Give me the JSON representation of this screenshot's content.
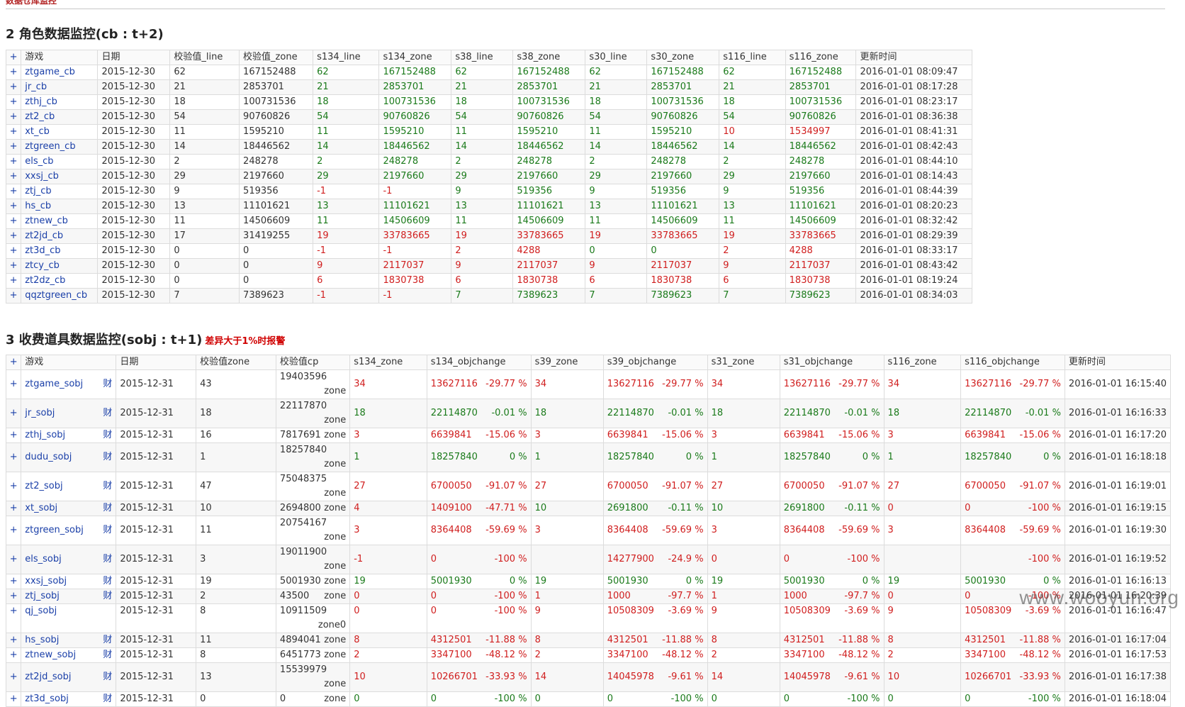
{
  "header": {
    "title": "数据仓库监控"
  },
  "section2": {
    "title": "2 角色数据监控(cb : t+2)",
    "columns": [
      "+",
      "游戏",
      "日期",
      "校验值_line",
      "校验值_zone",
      "s134_line",
      "s134_zone",
      "s38_line",
      "s38_zone",
      "s30_line",
      "s30_zone",
      "s116_line",
      "s116_zone",
      "更新时间"
    ],
    "rows": [
      [
        "ztgame_cb",
        "2015-12-30",
        "62",
        "167152488",
        "62",
        "167152488",
        "62",
        "167152488",
        "62",
        "167152488",
        "62",
        "167152488",
        "2016-01-01 08:09:47"
      ],
      [
        "jr_cb",
        "2015-12-30",
        "21",
        "2853701",
        "21",
        "2853701",
        "21",
        "2853701",
        "21",
        "2853701",
        "21",
        "2853701",
        "2016-01-01 08:17:28"
      ],
      [
        "zthj_cb",
        "2015-12-30",
        "18",
        "100731536",
        "18",
        "100731536",
        "18",
        "100731536",
        "18",
        "100731536",
        "18",
        "100731536",
        "2016-01-01 08:23:17"
      ],
      [
        "zt2_cb",
        "2015-12-30",
        "54",
        "90760826",
        "54",
        "90760826",
        "54",
        "90760826",
        "54",
        "90760826",
        "54",
        "90760826",
        "2016-01-01 08:36:38"
      ],
      [
        "xt_cb",
        "2015-12-30",
        "11",
        "1595210",
        "11",
        "1595210",
        "11",
        "1595210",
        "11",
        "1595210",
        "10",
        "1534997",
        "2016-01-01 08:41:31"
      ],
      [
        "ztgreen_cb",
        "2015-12-30",
        "14",
        "18446562",
        "14",
        "18446562",
        "14",
        "18446562",
        "14",
        "18446562",
        "14",
        "18446562",
        "2016-01-01 08:42:43"
      ],
      [
        "els_cb",
        "2015-12-30",
        "2",
        "248278",
        "2",
        "248278",
        "2",
        "248278",
        "2",
        "248278",
        "2",
        "248278",
        "2016-01-01 08:44:10"
      ],
      [
        "xxsj_cb",
        "2015-12-30",
        "29",
        "2197660",
        "29",
        "2197660",
        "29",
        "2197660",
        "29",
        "2197660",
        "29",
        "2197660",
        "2016-01-01 08:14:43"
      ],
      [
        "ztj_cb",
        "2015-12-30",
        "9",
        "519356",
        "-1",
        "-1",
        "9",
        "519356",
        "9",
        "519356",
        "9",
        "519356",
        "2016-01-01 08:44:39"
      ],
      [
        "hs_cb",
        "2015-12-30",
        "13",
        "11101621",
        "13",
        "11101621",
        "13",
        "11101621",
        "13",
        "11101621",
        "13",
        "11101621",
        "2016-01-01 08:20:23"
      ],
      [
        "ztnew_cb",
        "2015-12-30",
        "11",
        "14506609",
        "11",
        "14506609",
        "11",
        "14506609",
        "11",
        "14506609",
        "11",
        "14506609",
        "2016-01-01 08:32:42"
      ],
      [
        "zt2jd_cb",
        "2015-12-30",
        "17",
        "31419255",
        "19",
        "33783665",
        "19",
        "33783665",
        "19",
        "33783665",
        "19",
        "33783665",
        "2016-01-01 08:29:39"
      ],
      [
        "zt3d_cb",
        "2015-12-30",
        "0",
        "0",
        "-1",
        "-1",
        "2",
        "4288",
        "0",
        "0",
        "2",
        "4288",
        "2016-01-01 08:33:17"
      ],
      [
        "ztcy_cb",
        "2015-12-30",
        "0",
        "0",
        "9",
        "2117037",
        "9",
        "2117037",
        "9",
        "2117037",
        "9",
        "2117037",
        "2016-01-01 08:43:42"
      ],
      [
        "zt2dz_cb",
        "2015-12-30",
        "0",
        "0",
        "6",
        "1830738",
        "6",
        "1830738",
        "6",
        "1830738",
        "6",
        "1830738",
        "2016-01-01 08:19:24"
      ],
      [
        "qqztgreen_cb",
        "2015-12-30",
        "7",
        "7389623",
        "-1",
        "-1",
        "7",
        "7389623",
        "7",
        "7389623",
        "7",
        "7389623",
        "2016-01-01 08:34:03"
      ]
    ],
    "row_colors": [
      [
        "g",
        "g",
        "g",
        "g",
        "g",
        "g",
        "g",
        "g"
      ],
      [
        "g",
        "g",
        "g",
        "g",
        "g",
        "g",
        "g",
        "g"
      ],
      [
        "g",
        "g",
        "g",
        "g",
        "g",
        "g",
        "g",
        "g"
      ],
      [
        "g",
        "g",
        "g",
        "g",
        "g",
        "g",
        "g",
        "g"
      ],
      [
        "g",
        "g",
        "g",
        "g",
        "g",
        "g",
        "r",
        "r"
      ],
      [
        "g",
        "g",
        "g",
        "g",
        "g",
        "g",
        "g",
        "g"
      ],
      [
        "g",
        "g",
        "g",
        "g",
        "g",
        "g",
        "g",
        "g"
      ],
      [
        "g",
        "g",
        "g",
        "g",
        "g",
        "g",
        "g",
        "g"
      ],
      [
        "r",
        "r",
        "g",
        "g",
        "g",
        "g",
        "g",
        "g"
      ],
      [
        "g",
        "g",
        "g",
        "g",
        "g",
        "g",
        "g",
        "g"
      ],
      [
        "g",
        "g",
        "g",
        "g",
        "g",
        "g",
        "g",
        "g"
      ],
      [
        "r",
        "r",
        "r",
        "r",
        "r",
        "r",
        "r",
        "r"
      ],
      [
        "r",
        "r",
        "r",
        "r",
        "g",
        "g",
        "r",
        "r"
      ],
      [
        "r",
        "r",
        "r",
        "r",
        "r",
        "r",
        "r",
        "r"
      ],
      [
        "r",
        "r",
        "r",
        "r",
        "r",
        "r",
        "r",
        "r"
      ],
      [
        "r",
        "r",
        "g",
        "g",
        "g",
        "g",
        "g",
        "g"
      ]
    ]
  },
  "section3": {
    "title": "3 收费道具数据监控(sobj : t+1)",
    "warning": "差异大于1%时报警",
    "columns": [
      "+",
      "游戏",
      "日期",
      "校验值zone",
      "校验值cp",
      "s134_zone",
      "s134_objchange",
      "s39_zone",
      "s39_objchange",
      "s31_zone",
      "s31_objchange",
      "s116_zone",
      "s116_objchange",
      "更新时间"
    ],
    "cai_label": "财",
    "rows": [
      {
        "game": "ztgame_sobj",
        "cai": true,
        "date": "2015-12-31",
        "zone": "43",
        "cp": "19403596",
        "cp_suffix": "zone",
        "v": [
          [
            "34",
            "r"
          ],
          [
            "13627116",
            "-29.77 %",
            "r"
          ],
          [
            "34",
            "r"
          ],
          [
            "13627116",
            "-29.77 %",
            "r"
          ],
          [
            "34",
            "r"
          ],
          [
            "13627116",
            "-29.77 %",
            "r"
          ],
          [
            "34",
            "r"
          ],
          [
            "13627116",
            "-29.77 %",
            "r"
          ]
        ],
        "time": "2016-01-01 16:15:40"
      },
      {
        "game": "jr_sobj",
        "cai": true,
        "date": "2015-12-31",
        "zone": "18",
        "cp": "22117870",
        "cp_suffix": "zone",
        "v": [
          [
            "18",
            "g"
          ],
          [
            "22114870",
            "-0.01 %",
            "g"
          ],
          [
            "18",
            "g"
          ],
          [
            "22114870",
            "-0.01 %",
            "g"
          ],
          [
            "18",
            "g"
          ],
          [
            "22114870",
            "-0.01 %",
            "g"
          ],
          [
            "18",
            "g"
          ],
          [
            "22114870",
            "-0.01 %",
            "g"
          ]
        ],
        "time": "2016-01-01 16:16:33"
      },
      {
        "game": "zthj_sobj",
        "cai": true,
        "date": "2015-12-31",
        "zone": "16",
        "cp": "7817691",
        "cp_suffix": "zone",
        "v": [
          [
            "3",
            "r"
          ],
          [
            "6639841",
            "-15.06 %",
            "r"
          ],
          [
            "3",
            "r"
          ],
          [
            "6639841",
            "-15.06 %",
            "r"
          ],
          [
            "3",
            "r"
          ],
          [
            "6639841",
            "-15.06 %",
            "r"
          ],
          [
            "3",
            "r"
          ],
          [
            "6639841",
            "-15.06 %",
            "r"
          ]
        ],
        "time": "2016-01-01 16:17:20"
      },
      {
        "game": "dudu_sobj",
        "cai": true,
        "date": "2015-12-31",
        "zone": "1",
        "cp": "18257840",
        "cp_suffix": "zone",
        "v": [
          [
            "1",
            "g"
          ],
          [
            "18257840",
            "0 %",
            "g"
          ],
          [
            "1",
            "g"
          ],
          [
            "18257840",
            "0 %",
            "g"
          ],
          [
            "1",
            "g"
          ],
          [
            "18257840",
            "0 %",
            "g"
          ],
          [
            "1",
            "g"
          ],
          [
            "18257840",
            "0 %",
            "g"
          ]
        ],
        "time": "2016-01-01 16:18:18"
      },
      {
        "game": "zt2_sobj",
        "cai": true,
        "date": "2015-12-31",
        "zone": "47",
        "cp": "75048375",
        "cp_suffix": "zone",
        "v": [
          [
            "27",
            "r"
          ],
          [
            "6700050",
            "-91.07 %",
            "r"
          ],
          [
            "27",
            "r"
          ],
          [
            "6700050",
            "-91.07 %",
            "r"
          ],
          [
            "27",
            "r"
          ],
          [
            "6700050",
            "-91.07 %",
            "r"
          ],
          [
            "27",
            "r"
          ],
          [
            "6700050",
            "-91.07 %",
            "r"
          ]
        ],
        "time": "2016-01-01 16:19:01"
      },
      {
        "game": "xt_sobj",
        "cai": true,
        "date": "2015-12-31",
        "zone": "10",
        "cp": "2694800",
        "cp_suffix": "zone",
        "v": [
          [
            "4",
            "r"
          ],
          [
            "1409100",
            "-47.71 %",
            "r"
          ],
          [
            "10",
            "g"
          ],
          [
            "2691800",
            "-0.11 %",
            "g"
          ],
          [
            "10",
            "g"
          ],
          [
            "2691800",
            "-0.11 %",
            "g"
          ],
          [
            "0",
            "r"
          ],
          [
            "0",
            "-100 %",
            "r"
          ]
        ],
        "time": "2016-01-01 16:19:15"
      },
      {
        "game": "ztgreen_sobj",
        "cai": true,
        "date": "2015-12-31",
        "zone": "11",
        "cp": "20754167",
        "cp_suffix": "zone",
        "v": [
          [
            "3",
            "r"
          ],
          [
            "8364408",
            "-59.69 %",
            "r"
          ],
          [
            "3",
            "r"
          ],
          [
            "8364408",
            "-59.69 %",
            "r"
          ],
          [
            "3",
            "r"
          ],
          [
            "8364408",
            "-59.69 %",
            "r"
          ],
          [
            "3",
            "r"
          ],
          [
            "8364408",
            "-59.69 %",
            "r"
          ]
        ],
        "time": "2016-01-01 16:19:30"
      },
      {
        "game": "els_sobj",
        "cai": true,
        "date": "2015-12-31",
        "zone": "3",
        "cp": "19011900",
        "cp_suffix": "zone",
        "v": [
          [
            "-1",
            "r"
          ],
          [
            "0",
            "-100 %",
            "r"
          ],
          [
            "",
            "r"
          ],
          [
            "14277900",
            "-24.9 %",
            "r"
          ],
          [
            "0",
            "r"
          ],
          [
            "0",
            "-100 %",
            "r"
          ],
          [
            "",
            "r"
          ],
          [
            "",
            "-100 %",
            "r"
          ]
        ],
        "time": "2016-01-01 16:19:52"
      },
      {
        "game": "xxsj_sobj",
        "cai": true,
        "date": "2015-12-31",
        "zone": "19",
        "cp": "5001930",
        "cp_suffix": "zone",
        "v": [
          [
            "19",
            "g"
          ],
          [
            "5001930",
            "0 %",
            "g"
          ],
          [
            "19",
            "g"
          ],
          [
            "5001930",
            "0 %",
            "g"
          ],
          [
            "19",
            "g"
          ],
          [
            "5001930",
            "0 %",
            "g"
          ],
          [
            "19",
            "g"
          ],
          [
            "5001930",
            "0 %",
            "g"
          ]
        ],
        "time": "2016-01-01 16:16:13"
      },
      {
        "game": "ztj_sobj",
        "cai": true,
        "date": "2015-12-31",
        "zone": "2",
        "cp": "43500",
        "cp_suffix": "zone",
        "v": [
          [
            "0",
            "r"
          ],
          [
            "0",
            "-100 %",
            "r"
          ],
          [
            "1",
            "r"
          ],
          [
            "1000",
            "-97.7 %",
            "r"
          ],
          [
            "1",
            "r"
          ],
          [
            "1000",
            "-97.7 %",
            "r"
          ],
          [
            "0",
            "r"
          ],
          [
            "0",
            "-100 %",
            "r"
          ]
        ],
        "time": "2016-01-01 16:20:39"
      },
      {
        "game": "qj_sobj",
        "cai": false,
        "tall": true,
        "date": "2015-12-31",
        "zone": "8",
        "cp": "10911509",
        "cp_suffix": "zone0",
        "v": [
          [
            "0",
            "r"
          ],
          [
            "0",
            "-100 %",
            "r"
          ],
          [
            "9",
            "r"
          ],
          [
            "10508309",
            "-3.69 %",
            "r"
          ],
          [
            "9",
            "r"
          ],
          [
            "10508309",
            "-3.69 %",
            "r"
          ],
          [
            "9",
            "r"
          ],
          [
            "10508309",
            "-3.69 %",
            "r"
          ]
        ],
        "time": "2016-01-01 16:16:47"
      },
      {
        "game": "hs_sobj",
        "cai": true,
        "date": "2015-12-31",
        "zone": "11",
        "cp": "4894041",
        "cp_suffix": "zone",
        "v": [
          [
            "8",
            "r"
          ],
          [
            "4312501",
            "-11.88 %",
            "r"
          ],
          [
            "8",
            "r"
          ],
          [
            "4312501",
            "-11.88 %",
            "r"
          ],
          [
            "8",
            "r"
          ],
          [
            "4312501",
            "-11.88 %",
            "r"
          ],
          [
            "8",
            "r"
          ],
          [
            "4312501",
            "-11.88 %",
            "r"
          ]
        ],
        "time": "2016-01-01 16:17:04"
      },
      {
        "game": "ztnew_sobj",
        "cai": true,
        "date": "2015-12-31",
        "zone": "8",
        "cp": "6451773",
        "cp_suffix": "zone",
        "v": [
          [
            "2",
            "r"
          ],
          [
            "3347100",
            "-48.12 %",
            "r"
          ],
          [
            "2",
            "r"
          ],
          [
            "3347100",
            "-48.12 %",
            "r"
          ],
          [
            "2",
            "r"
          ],
          [
            "3347100",
            "-48.12 %",
            "r"
          ],
          [
            "2",
            "r"
          ],
          [
            "3347100",
            "-48.12 %",
            "r"
          ]
        ],
        "time": "2016-01-01 16:17:53"
      },
      {
        "game": "zt2jd_sobj",
        "cai": true,
        "date": "2015-12-31",
        "zone": "13",
        "cp": "15539979",
        "cp_suffix": "zone",
        "v": [
          [
            "10",
            "r"
          ],
          [
            "10266701",
            "-33.93 %",
            "r"
          ],
          [
            "14",
            "r"
          ],
          [
            "14045978",
            "-9.61 %",
            "r"
          ],
          [
            "14",
            "r"
          ],
          [
            "14045978",
            "-9.61 %",
            "r"
          ],
          [
            "10",
            "r"
          ],
          [
            "10266701",
            "-33.93 %",
            "r"
          ]
        ],
        "time": "2016-01-01 16:17:38"
      },
      {
        "game": "zt3d_sobj",
        "cai": true,
        "date": "2015-12-31",
        "zone": "0",
        "cp": "0",
        "cp_suffix": "zone",
        "v": [
          [
            "0",
            "g"
          ],
          [
            "0",
            "-100 %",
            "g"
          ],
          [
            "0",
            "g"
          ],
          [
            "0",
            "-100 %",
            "g"
          ],
          [
            "0",
            "g"
          ],
          [
            "0",
            "-100 %",
            "g"
          ],
          [
            "0",
            "g"
          ],
          [
            "0",
            "-100 %",
            "g"
          ]
        ],
        "time": "2016-01-01 16:18:04"
      }
    ]
  },
  "watermark": "www.wooyun.org"
}
